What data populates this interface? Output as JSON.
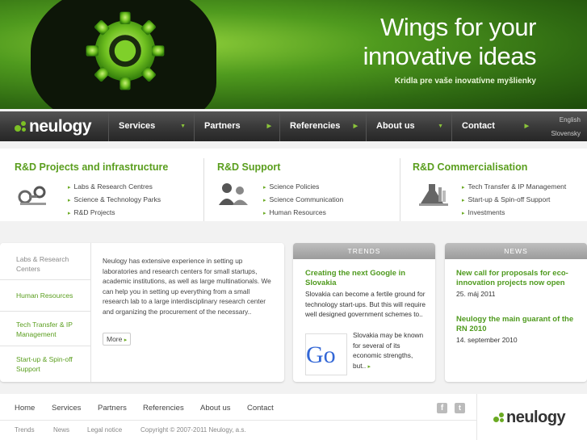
{
  "banner": {
    "headline_line1": "Wings for your",
    "headline_line2": "innovative ideas",
    "subline": "Kridla pre vaše inovatívne myšlienky"
  },
  "brand": {
    "name": "neulogy",
    "accent": "#5a9e1e"
  },
  "nav": {
    "items": [
      {
        "label": "Services"
      },
      {
        "label": "Partners"
      },
      {
        "label": "Referencies"
      },
      {
        "label": "About us"
      },
      {
        "label": "Contact"
      }
    ],
    "lang_en": "English",
    "lang_sk": "Slovensky"
  },
  "sections": [
    {
      "title": "R&D Projects and infrastructure",
      "icon": "microscope-icon",
      "items": [
        "Labs & Research Centres",
        "Science & Technology Parks",
        "R&D Projects"
      ]
    },
    {
      "title": "R&D Support",
      "icon": "people-icon",
      "items": [
        "Science Policies",
        "Science Communication",
        "Human Resources"
      ]
    },
    {
      "title": "R&D Commercialisation",
      "icon": "flask-icon",
      "items": [
        "Tech Transfer & IP Management",
        "Start-up & Spin-off Support",
        "Investments"
      ]
    }
  ],
  "side_menu": [
    "Labs & Research Centers",
    "Human Resources",
    "Tech Transfer & IP Management",
    "Start-up & Spin-off Support"
  ],
  "intro": {
    "text": "Neulogy has extensive experience in setting up laboratories and research centers for small startups, academic institutions, as well as large multinationals. We can help you in setting up everything from a small research lab to a large interdisciplinary research center and organizing the procurement of the necessary..",
    "more": "More"
  },
  "trends": {
    "header": "TRENDS",
    "title": "Creating the next Google in Slovakia",
    "text": "Slovakia can become a fertile ground for technology start-ups. But this will require well designed government schemes to..",
    "text2": "Slovakia may be known for several of its economic strengths, but..",
    "thumb": "Go"
  },
  "news": {
    "header": "NEWS",
    "items": [
      {
        "title": "New call for proposals for eco-innovation projects now open",
        "date": "25. máj 2011"
      },
      {
        "title": "Neulogy the main guarant of the RN 2010",
        "date": "14. september 2010"
      }
    ]
  },
  "footer": {
    "links": [
      "Home",
      "Services",
      "Partners",
      "Referencies",
      "About us",
      "Contact"
    ],
    "links2": [
      "Trends",
      "News",
      "Legal notice"
    ],
    "copyright": "Copyright © 2007-2011 Neulogy, a.s."
  }
}
